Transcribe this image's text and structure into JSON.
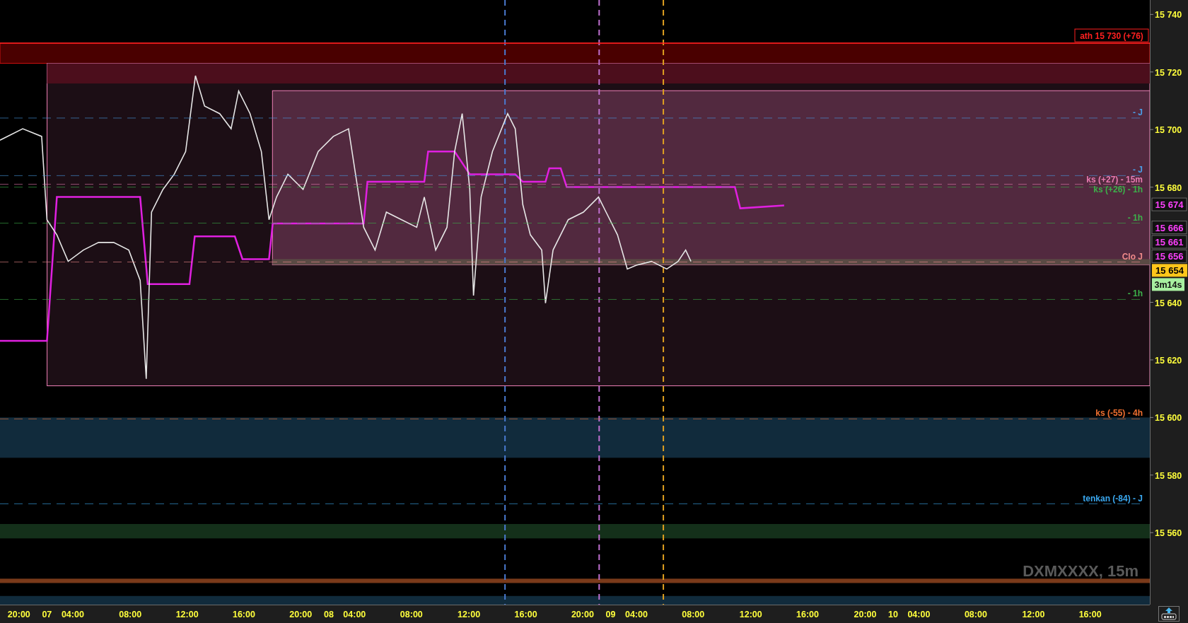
{
  "chart": {
    "symbol": "DXMXXXX, 15m",
    "x_axis": [
      "20:00",
      "07",
      "04:00",
      "08:00",
      "12:00",
      "16:00",
      "20:00",
      "08",
      "04:00",
      "08:00",
      "12:00",
      "16:00",
      "20:00",
      "09",
      "04:00",
      "08:00",
      "12:00",
      "16:00",
      "20:00",
      "10",
      "04:00",
      "08:00",
      "12:00",
      "16:00"
    ],
    "y_axis": [
      "15 740",
      "15 720",
      "15 700",
      "15 680",
      "15 640",
      "15 620",
      "15 600",
      "15 580",
      "15 560"
    ],
    "zones": [
      {
        "kind": "box",
        "color": "#4a0000"
      },
      {
        "kind": "box",
        "color": "#1c0e15"
      },
      {
        "kind": "band",
        "color": "#4c0e1c"
      },
      {
        "kind": "box",
        "color": "#52293f"
      },
      {
        "kind": "band",
        "color": "#5a4a44"
      },
      {
        "kind": "band",
        "color": "#112b3c"
      },
      {
        "kind": "band",
        "color": "#14301a"
      },
      {
        "kind": "band",
        "color": "#7a3a1a"
      },
      {
        "kind": "band",
        "color": "#112b3c"
      }
    ],
    "levels": [
      {
        "kind": "boxed",
        "label": "ath 15 730 (+76)",
        "color": "#ff2020"
      },
      {
        "kind": "dashed",
        "label": "- J",
        "color": "#4a9ee8"
      },
      {
        "kind": "dashed",
        "label": "- J",
        "color": "#4a9ee8"
      },
      {
        "kind": "dashed",
        "label": "ks (+27) - 15m",
        "color": "#e87ab0"
      },
      {
        "kind": "dashed",
        "label": "ks (+26) - 1h",
        "color": "#3cb04a"
      },
      {
        "kind": "dashed",
        "label": "- 1h",
        "color": "#3cb04a"
      },
      {
        "kind": "dashed",
        "label": "Clo J",
        "color": "#f08a8a"
      },
      {
        "kind": "dashed",
        "label": "- 1h",
        "color": "#3cb04a"
      },
      {
        "kind": "dashed",
        "label": "ks (-55) - 4h",
        "color": "#f07030"
      },
      {
        "kind": "dashed",
        "label": "tenkan (-84) - J",
        "color": "#3aa8f0"
      }
    ],
    "verticals": [
      {
        "color": "#4a7ad0"
      },
      {
        "color": "#c070d0"
      },
      {
        "color": "#e0a020"
      }
    ],
    "price_markers": [
      {
        "kind": "indicator",
        "label": "15 674"
      },
      {
        "kind": "indicator",
        "label": "15 666"
      },
      {
        "kind": "indicator",
        "label": "15 661"
      },
      {
        "kind": "indicator",
        "label": "15 656"
      },
      {
        "kind": "current",
        "label": "15 654"
      }
    ],
    "timer": "3m14s"
  }
}
